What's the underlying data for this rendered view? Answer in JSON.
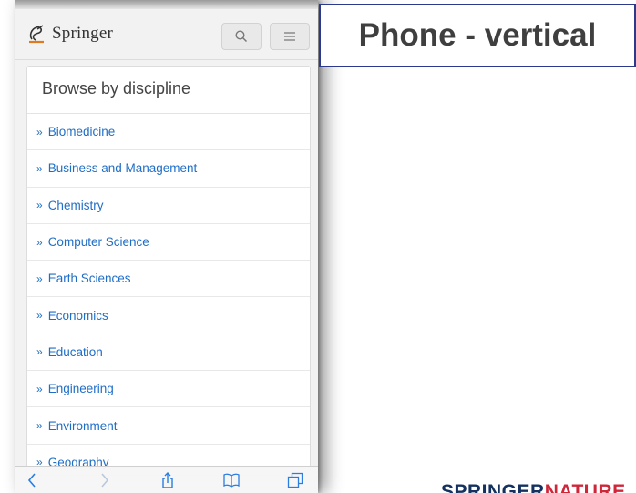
{
  "header": {
    "brand": "Springer"
  },
  "browse": {
    "title": "Browse by discipline",
    "chevron": "»",
    "items": [
      "Biomedicine",
      "Business and Management",
      "Chemistry",
      "Computer Science",
      "Earth Sciences",
      "Economics",
      "Education",
      "Engineering",
      "Environment",
      "Geography"
    ]
  },
  "label": {
    "text": "Phone - vertical"
  },
  "footer_brand": {
    "part1": "SPRINGER",
    "part2": "NATURE"
  },
  "icons": [
    "springer-logo-icon",
    "search-icon",
    "menu-icon",
    "back-icon",
    "forward-icon",
    "share-icon",
    "bookmarks-icon",
    "tabs-icon"
  ],
  "colors": {
    "link": "#1f6ec6",
    "frame": "#2b3a8c",
    "brand_blue": "#14315f",
    "brand_red": "#d0263a"
  }
}
